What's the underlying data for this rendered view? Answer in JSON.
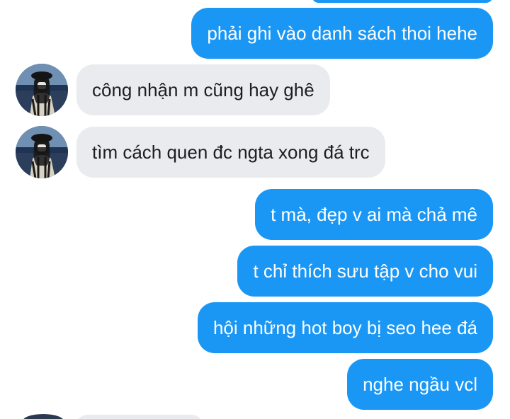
{
  "messages": [
    {
      "direction": "sent",
      "text": "phải ghi vào danh sách thoi hehe"
    },
    {
      "direction": "received",
      "text": "công nhận m cũng hay ghê"
    },
    {
      "direction": "received",
      "text": "tìm cách quen đc ngta xong đá trc"
    },
    {
      "direction": "sent",
      "text": "t mà, đẹp v ai mà chả mê"
    },
    {
      "direction": "sent",
      "text": "t chỉ thích sưu tập v cho vui"
    },
    {
      "direction": "sent",
      "text": "hội những hot boy bị seo hee đá"
    },
    {
      "direction": "sent",
      "text": "nghe ngầu vcl"
    }
  ],
  "colors": {
    "sent_bubble": "#1a97f5",
    "received_bubble": "#e9ebee",
    "sent_text": "#ffffff",
    "received_text": "#1c1e21"
  },
  "icons": {
    "avatar": "contact-avatar-photo"
  }
}
